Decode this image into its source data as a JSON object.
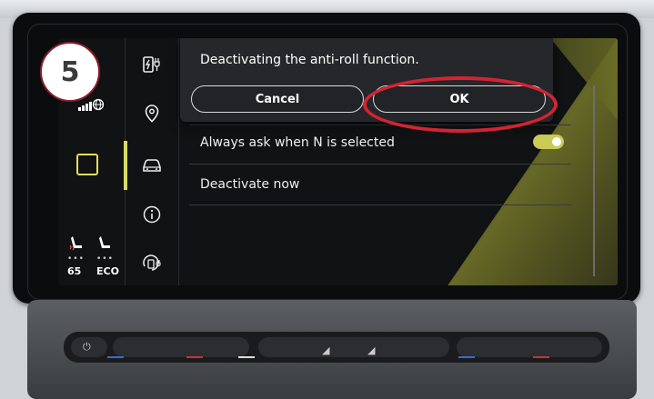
{
  "step_badge": "5",
  "dialog": {
    "title": "Deactivating the anti-roll function.",
    "cancel_label": "Cancel",
    "ok_label": "OK"
  },
  "settings": {
    "always_ask_label": "Always ask when N is selected",
    "always_ask_enabled": true,
    "deactivate_now_label": "Deactivate now"
  },
  "status": {
    "seat_left_value": "65",
    "seat_right_value": "ECO"
  },
  "icons": {
    "rail": [
      "charging-icon",
      "location-pin-icon",
      "car-icon",
      "info-icon",
      "charge-timer-icon"
    ],
    "status": [
      "signal-icon",
      "home-button-icon",
      "heated-seat-icon",
      "seat-eco-icon"
    ]
  },
  "colors": {
    "accent": "#d7d964",
    "highlight": "#d42433"
  }
}
